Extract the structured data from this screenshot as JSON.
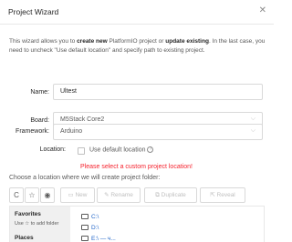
{
  "dialog": {
    "title": "Project Wizard",
    "close": "✕"
  },
  "intro": {
    "part1": "This wizard allows you to ",
    "bold1": "create new",
    "part2": " PlatformIO project or ",
    "bold2": "update existing",
    "part3": ". In the last case, you need to uncheck \"Use default location\" and specify path to existing project."
  },
  "form": {
    "name_label": "Name:",
    "name_value": "Ultest",
    "board_label": "Board:",
    "board_value": "M5Stack Core2",
    "framework_label": "Framework:",
    "framework_value": "Arduino",
    "location_label": "Location:",
    "use_default_label": "Use default location",
    "use_default_checked": false,
    "help_glyph": "?"
  },
  "error": "Please select a custom project location!",
  "choose_label": "Choose a location where we will create project folder:",
  "toolbar": {
    "refresh": "C",
    "star": "☆",
    "eye": "◉",
    "new": "New",
    "rename": "Rename",
    "duplicate": "Duplicate",
    "reveal": "Reveal"
  },
  "browser": {
    "favorites_title": "Favorites",
    "favorites_hint": "Use ☆ to add folder",
    "places_title": "Places",
    "folders": [
      "C:\\",
      "D:\\",
      "E:\\ — ч..."
    ]
  }
}
